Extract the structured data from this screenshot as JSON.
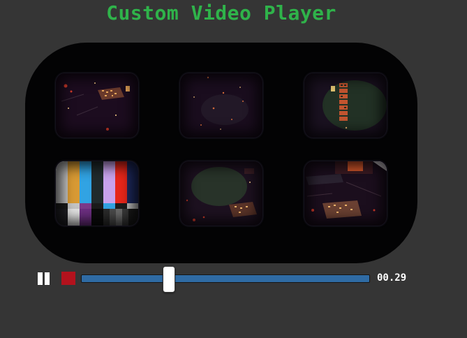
{
  "page": {
    "title": "Custom Video Player"
  },
  "video": {
    "screens": [
      {
        "name": "tv-screen-circuit-board"
      },
      {
        "name": "tv-screen-dark-particles"
      },
      {
        "name": "tv-screen-green-glow"
      },
      {
        "name": "tv-screen-color-bars"
      },
      {
        "name": "tv-screen-green-circuit"
      },
      {
        "name": "tv-screen-circuit-closeup"
      }
    ]
  },
  "controls": {
    "pause_icon": "pause-icon",
    "stop_icon": "stop-icon",
    "progress_fraction": 0.3,
    "time": "00.29",
    "colors": {
      "title": "#2fb34a",
      "track": "#2f6ba4",
      "stop": "#b3121d",
      "thumb": "#ffffff"
    }
  }
}
